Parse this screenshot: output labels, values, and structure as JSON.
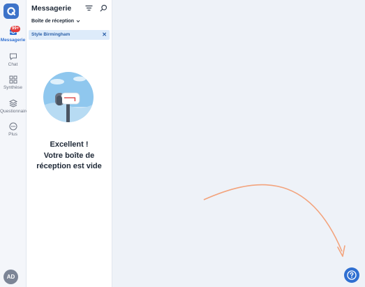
{
  "sidebar": {
    "items": [
      {
        "label": "Messagerie",
        "badge": "99+"
      },
      {
        "label": "Chat"
      },
      {
        "label": "Synthèse"
      },
      {
        "label": "Questionnaires"
      },
      {
        "label": "Plus"
      }
    ],
    "avatar": "AD"
  },
  "panel": {
    "title": "Messagerie",
    "inbox_select": "Boîte de réception",
    "filter_chip": "Style Birmingham",
    "empty": {
      "line1": "Excellent !",
      "line2": "Votre boîte de",
      "line3": "réception est vide"
    }
  },
  "colors": {
    "accent": "#2f6fd1",
    "badge": "#e23b3b",
    "chip_bg": "#ddebfa",
    "arrow": "#f3a37c"
  },
  "icons": [
    "logo-icon",
    "inbox-icon",
    "chat-icon",
    "grid-icon",
    "layers-icon",
    "more-icon",
    "filter-icon",
    "search-icon",
    "chevron-down-icon",
    "close-icon",
    "help-icon"
  ]
}
